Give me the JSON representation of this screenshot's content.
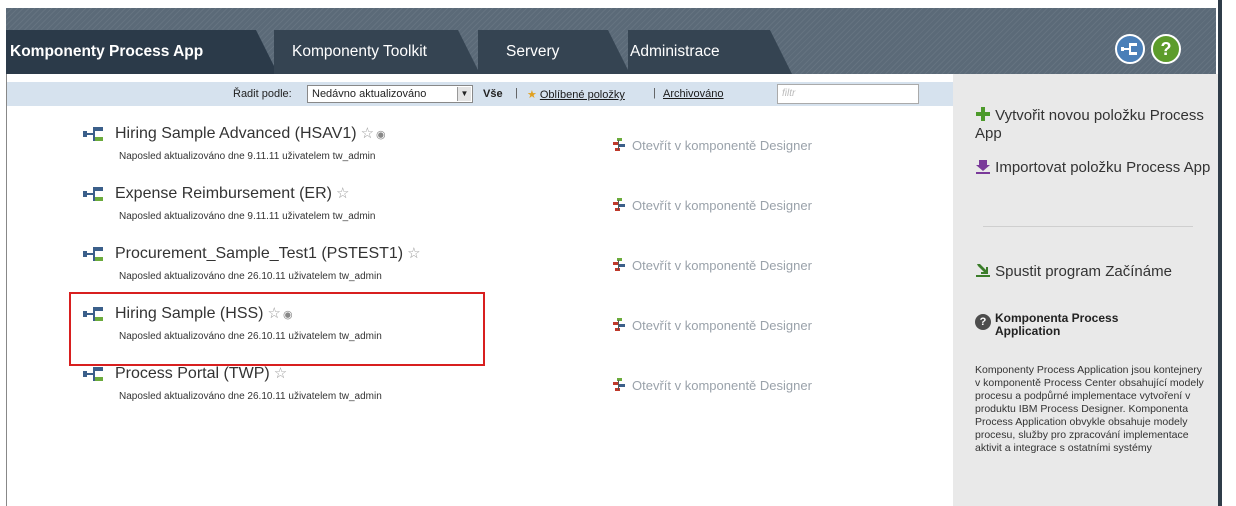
{
  "tabs": [
    {
      "label": "Komponenty Process App",
      "active": true
    },
    {
      "label": "Komponenty Toolkit",
      "active": false
    },
    {
      "label": "Servery",
      "active": false
    },
    {
      "label": "Administrace",
      "active": false
    }
  ],
  "header_buttons": {
    "toolkit_icon": "process-app-icon",
    "help_glyph": "?"
  },
  "filterbar": {
    "sort_label": "Řadit podle:",
    "sort_value": "Nedávno aktualizováno",
    "all": "Vše",
    "favorites": "Oblíbené položky",
    "archived": "Archivováno",
    "filter_placeholder": "filtr"
  },
  "apps": [
    {
      "title": "Hiring Sample Advanced (HSAV1)",
      "subtitle": "Naposled aktualizováno dne 9.11.11 uživatelem tw_admin",
      "open_label": "Otevřít v komponentě Designer",
      "info": true
    },
    {
      "title": "Expense Reimbursement (ER)",
      "subtitle": "Naposled aktualizováno dne 9.11.11 uživatelem tw_admin",
      "open_label": "Otevřít v komponentě Designer",
      "info": false
    },
    {
      "title": "Procurement_Sample_Test1 (PSTEST1)",
      "subtitle": "Naposled aktualizováno dne 26.10.11 uživatelem tw_admin",
      "open_label": "Otevřít v komponentě Designer",
      "info": false
    },
    {
      "title": "Hiring Sample (HSS)",
      "subtitle": "Naposled aktualizováno dne 26.10.11 uživatelem tw_admin",
      "open_label": "Otevřít v komponentě Designer",
      "info": true
    },
    {
      "title": "Process Portal (TWP)",
      "subtitle": "Naposled aktualizováno dne 26.10.11 uživatelem tw_admin",
      "open_label": "Otevřít v komponentě Designer",
      "info": false
    }
  ],
  "sidebar": {
    "create": "Vytvořit novou položku Process App",
    "import": "Importovat položku Process App",
    "start": "Spustit program Začínáme",
    "help_title": "Komponenta Process Application",
    "help_text": "Komponenty Process Application jsou kontejnery v komponentě Process Center obsahující modely procesu a podpůrné implementace vytvoření v produktu IBM Process Designer. Komponenta Process Application obvykle obsahuje modely procesu, služby pro zpracování implementace aktivit a integrace s ostatními systémy"
  },
  "colors": {
    "highlight": "#d81f1f",
    "header": "#354452",
    "active_tab": "#2b3a49",
    "filterbar": "#d6e2ee",
    "sidebar": "#e9e9e9"
  }
}
